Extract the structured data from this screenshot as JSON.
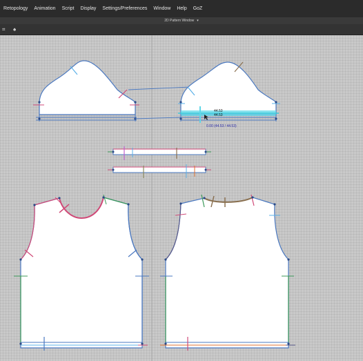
{
  "menu": {
    "items": [
      "Retopology",
      "Animation",
      "Script",
      "Display",
      "Settings/Preferences",
      "Window",
      "Help",
      "GoZ"
    ]
  },
  "window": {
    "title": "2D Pattern Window"
  },
  "toolbar": {
    "icons": [
      "pattern-select-icon",
      "shirt-icon"
    ]
  },
  "canvas": {
    "measure_label_top": "44.53",
    "measure_label_bottom": "44.53",
    "measure_readout": "0.00 (44.53 / 44.53)",
    "colors": {
      "outline_blue": "#4a78c0",
      "outline_pink": "#d04a78",
      "outline_green": "#3c9a5a",
      "highlight_cyan": "#5fd8e8",
      "measure_text": "#2a2aa8",
      "grid_bg": "#c9c9c9"
    }
  }
}
